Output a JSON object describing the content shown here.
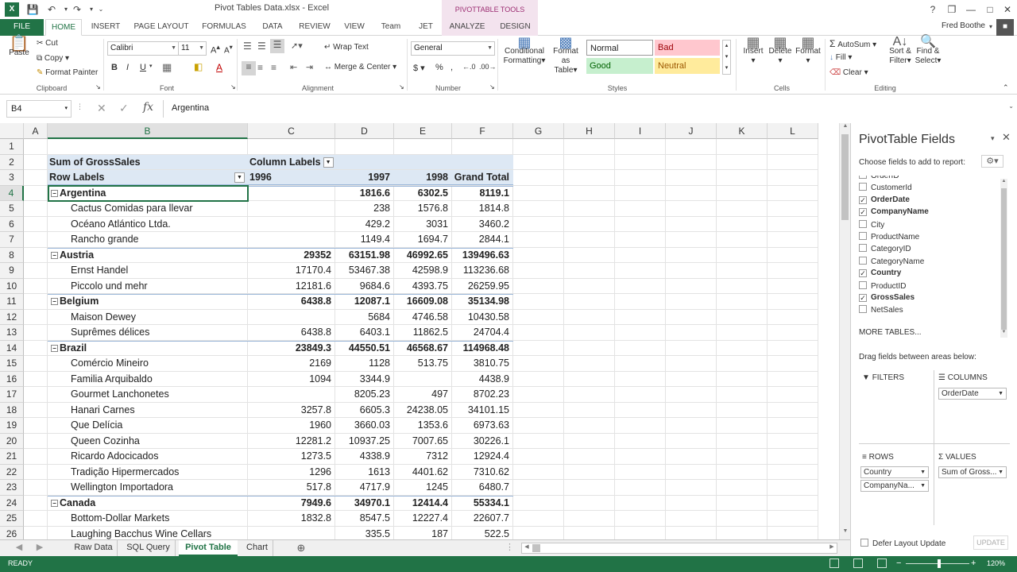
{
  "window": {
    "title": "Pivot Tables Data.xlsx - Excel",
    "contextual_tools": "PIVOTTABLE TOOLS"
  },
  "tabs": [
    "FILE",
    "HOME",
    "INSERT",
    "PAGE LAYOUT",
    "FORMULAS",
    "DATA",
    "REVIEW",
    "VIEW",
    "Team",
    "JET",
    "ANALYZE",
    "DESIGN"
  ],
  "user": "Fred Boothe",
  "ribbon": {
    "clipboard": {
      "paste": "Paste",
      "cut": "Cut",
      "copy": "Copy",
      "format_painter": "Format Painter",
      "label": "Clipboard"
    },
    "font": {
      "name": "Calibri",
      "size": "11",
      "label": "Font"
    },
    "alignment": {
      "wrap": "Wrap Text",
      "merge": "Merge & Center",
      "label": "Alignment"
    },
    "number": {
      "format": "General",
      "label": "Number"
    },
    "styles": {
      "cond": [
        "Conditional",
        "Formatting"
      ],
      "table": [
        "Format as",
        "Table"
      ],
      "normal": "Normal",
      "bad": "Bad",
      "good": "Good",
      "neutral": "Neutral",
      "label": "Styles"
    },
    "cells": {
      "insert": "Insert",
      "delete": "Delete",
      "format": "Format",
      "label": "Cells"
    },
    "editing": {
      "autosum": "AutoSum",
      "fill": "Fill",
      "clear": "Clear",
      "sort": [
        "Sort &",
        "Filter"
      ],
      "find": [
        "Find &",
        "Select"
      ],
      "label": "Editing"
    }
  },
  "formula_bar": {
    "name_box": "B4",
    "content": "Argentina"
  },
  "columns": [
    "A",
    "B",
    "C",
    "D",
    "E",
    "F",
    "G",
    "H",
    "I",
    "J",
    "K",
    "L"
  ],
  "pivot": {
    "value_title": "Sum of GrossSales",
    "column_labels": "Column Labels",
    "row_labels": "Row Labels",
    "years": [
      "1996",
      "1997",
      "1998",
      "Grand Total"
    ],
    "rows": [
      {
        "r": "1",
        "type": "blank"
      },
      {
        "r": "2",
        "type": "header1"
      },
      {
        "r": "3",
        "type": "header2"
      },
      {
        "r": "4",
        "type": "country",
        "label": "Argentina",
        "v": [
          "",
          "1816.6",
          "6302.5",
          "8119.1"
        ]
      },
      {
        "r": "5",
        "type": "company",
        "label": "Cactus Comidas para llevar",
        "v": [
          "",
          "238",
          "1576.8",
          "1814.8"
        ]
      },
      {
        "r": "6",
        "type": "company",
        "label": "Océano Atlántico Ltda.",
        "v": [
          "",
          "429.2",
          "3031",
          "3460.2"
        ]
      },
      {
        "r": "7",
        "type": "company",
        "label": "Rancho grande",
        "v": [
          "",
          "1149.4",
          "1694.7",
          "2844.1"
        ]
      },
      {
        "r": "8",
        "type": "country",
        "label": "Austria",
        "v": [
          "29352",
          "63151.98",
          "46992.65",
          "139496.63"
        ]
      },
      {
        "r": "9",
        "type": "company",
        "label": "Ernst Handel",
        "v": [
          "17170.4",
          "53467.38",
          "42598.9",
          "113236.68"
        ]
      },
      {
        "r": "10",
        "type": "company",
        "label": "Piccolo und mehr",
        "v": [
          "12181.6",
          "9684.6",
          "4393.75",
          "26259.95"
        ]
      },
      {
        "r": "11",
        "type": "country",
        "label": "Belgium",
        "v": [
          "6438.8",
          "12087.1",
          "16609.08",
          "35134.98"
        ]
      },
      {
        "r": "12",
        "type": "company",
        "label": "Maison Dewey",
        "v": [
          "",
          "5684",
          "4746.58",
          "10430.58"
        ]
      },
      {
        "r": "13",
        "type": "company",
        "label": "Suprêmes délices",
        "v": [
          "6438.8",
          "6403.1",
          "11862.5",
          "24704.4"
        ]
      },
      {
        "r": "14",
        "type": "country",
        "label": "Brazil",
        "v": [
          "23849.3",
          "44550.51",
          "46568.67",
          "114968.48"
        ]
      },
      {
        "r": "15",
        "type": "company",
        "label": "Comércio Mineiro",
        "v": [
          "2169",
          "1128",
          "513.75",
          "3810.75"
        ]
      },
      {
        "r": "16",
        "type": "company",
        "label": "Familia Arquibaldo",
        "v": [
          "1094",
          "3344.9",
          "",
          "4438.9"
        ]
      },
      {
        "r": "17",
        "type": "company",
        "label": "Gourmet Lanchonetes",
        "v": [
          "",
          "8205.23",
          "497",
          "8702.23"
        ]
      },
      {
        "r": "18",
        "type": "company",
        "label": "Hanari Carnes",
        "v": [
          "3257.8",
          "6605.3",
          "24238.05",
          "34101.15"
        ]
      },
      {
        "r": "19",
        "type": "company",
        "label": "Que Delícia",
        "v": [
          "1960",
          "3660.03",
          "1353.6",
          "6973.63"
        ]
      },
      {
        "r": "20",
        "type": "company",
        "label": "Queen Cozinha",
        "v": [
          "12281.2",
          "10937.25",
          "7007.65",
          "30226.1"
        ]
      },
      {
        "r": "21",
        "type": "company",
        "label": "Ricardo Adocicados",
        "v": [
          "1273.5",
          "4338.9",
          "7312",
          "12924.4"
        ]
      },
      {
        "r": "22",
        "type": "company",
        "label": "Tradição Hipermercados",
        "v": [
          "1296",
          "1613",
          "4401.62",
          "7310.62"
        ]
      },
      {
        "r": "23",
        "type": "company",
        "label": "Wellington Importadora",
        "v": [
          "517.8",
          "4717.9",
          "1245",
          "6480.7"
        ]
      },
      {
        "r": "24",
        "type": "country",
        "label": "Canada",
        "v": [
          "7949.6",
          "34970.1",
          "12414.4",
          "55334.1"
        ]
      },
      {
        "r": "25",
        "type": "company",
        "label": "Bottom-Dollar Markets",
        "v": [
          "1832.8",
          "8547.5",
          "12227.4",
          "22607.7"
        ]
      },
      {
        "r": "26",
        "type": "company",
        "label": "Laughing Bacchus Wine Cellars",
        "v": [
          "",
          "335.5",
          "187",
          "522.5"
        ]
      }
    ]
  },
  "sheet_tabs": [
    "Raw Data",
    "SQL Query",
    "Pivot Table",
    "Chart"
  ],
  "active_sheet": "Pivot Table",
  "status": {
    "mode": "READY",
    "zoom": "120%"
  },
  "pane": {
    "title": "PivotTable Fields",
    "choose": "Choose fields to add to report:",
    "fields": [
      {
        "name": "OrderID",
        "checked": false
      },
      {
        "name": "CustomerId",
        "checked": false
      },
      {
        "name": "OrderDate",
        "checked": true
      },
      {
        "name": "CompanyName",
        "checked": true
      },
      {
        "name": "City",
        "checked": false
      },
      {
        "name": "ProductName",
        "checked": false
      },
      {
        "name": "CategoryID",
        "checked": false
      },
      {
        "name": "CategoryName",
        "checked": false
      },
      {
        "name": "Country",
        "checked": true
      },
      {
        "name": "ProductID",
        "checked": false
      },
      {
        "name": "GrossSales",
        "checked": true
      },
      {
        "name": "NetSales",
        "checked": false
      }
    ],
    "more_tables": "MORE TABLES...",
    "drag_hint": "Drag fields between areas below:",
    "filters_label": "FILTERS",
    "columns_label": "COLUMNS",
    "rows_label": "ROWS",
    "values_label": "VALUES",
    "columns_items": [
      "OrderDate"
    ],
    "rows_items": [
      "Country",
      "CompanyNa..."
    ],
    "values_items": [
      "Sum of Gross..."
    ],
    "defer": "Defer Layout Update",
    "update": "UPDATE"
  }
}
